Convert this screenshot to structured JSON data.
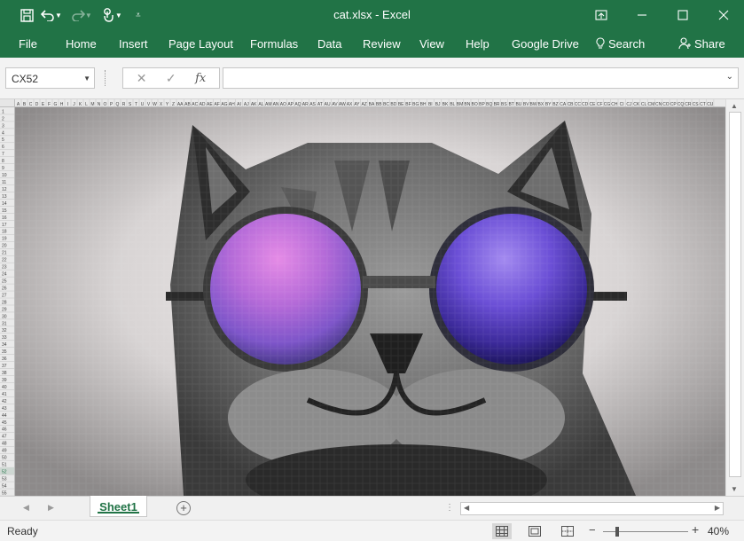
{
  "window": {
    "title": "cat.xlsx  -  Excel",
    "accent": "#217346"
  },
  "quick_access": [
    "save-icon",
    "undo-icon",
    "redo-icon",
    "touch-mode-icon",
    "customize-icon"
  ],
  "ribbon": {
    "tabs": [
      "File",
      "Home",
      "Insert",
      "Page Layout",
      "Formulas",
      "Data",
      "Review",
      "View",
      "Help",
      "Google Drive"
    ],
    "search_label": "Search",
    "share_label": "Share"
  },
  "formula_bar": {
    "name_box": "CX52",
    "fx_label": "fx",
    "formula": ""
  },
  "grid": {
    "column_headers": [
      "A",
      "B",
      "C",
      "D",
      "E",
      "F",
      "G",
      "H",
      "I",
      "J",
      "K",
      "L",
      "M",
      "N",
      "O",
      "P",
      "Q",
      "R",
      "S",
      "T",
      "U",
      "V",
      "W",
      "X",
      "Y",
      "Z",
      "AA",
      "AB",
      "AC",
      "AD",
      "AE",
      "AF",
      "AG",
      "AH",
      "AI",
      "AJ",
      "AK",
      "AL",
      "AM",
      "AN",
      "AO",
      "AP",
      "AQ",
      "AR",
      "AS",
      "AT",
      "AU",
      "AV",
      "AW",
      "AX",
      "AY",
      "AZ",
      "BA",
      "BB",
      "BC",
      "BD",
      "BE",
      "BF",
      "BG",
      "BH",
      "BI",
      "BJ",
      "BK",
      "BL",
      "BM",
      "BN",
      "BO",
      "BP",
      "BQ",
      "BR",
      "BS",
      "BT",
      "BU",
      "BV",
      "BW",
      "BX",
      "BY",
      "BZ",
      "CA",
      "CB",
      "CC",
      "CD",
      "CE",
      "CF",
      "CG",
      "CH",
      "CI",
      "CJ",
      "CK",
      "CL",
      "CM",
      "CN",
      "CO",
      "CP",
      "CQ",
      "CR",
      "CS",
      "CT",
      "CU"
    ],
    "row_headers": [
      "1",
      "2",
      "3",
      "4",
      "5",
      "6",
      "7",
      "8",
      "9",
      "10",
      "11",
      "12",
      "13",
      "14",
      "15",
      "16",
      "17",
      "18",
      "19",
      "20",
      "21",
      "22",
      "23",
      "24",
      "25",
      "26",
      "27",
      "28",
      "29",
      "30",
      "31",
      "32",
      "33",
      "34",
      "35",
      "36",
      "37",
      "38",
      "39",
      "40",
      "41",
      "42",
      "43",
      "44",
      "45",
      "46",
      "47",
      "48",
      "49",
      "50",
      "51",
      "52",
      "53",
      "54",
      "55"
    ],
    "selected_row": "52",
    "content_description_icon": "pixel-art-cat-with-sunglasses"
  },
  "sheets": {
    "tabs": [
      "Sheet1"
    ],
    "active": "Sheet1"
  },
  "status": {
    "text": "Ready",
    "zoom_label": "40%",
    "zoom_percent": 40
  }
}
